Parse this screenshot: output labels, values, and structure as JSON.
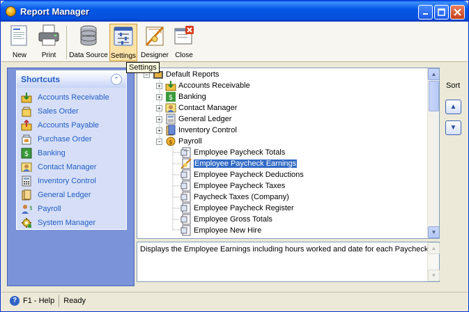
{
  "window": {
    "title": "Report Manager"
  },
  "toolbar": {
    "items": [
      {
        "label": "New",
        "icon": "new-document-icon"
      },
      {
        "label": "Print",
        "icon": "printer-icon"
      },
      {
        "label": "Data Source",
        "icon": "database-icon"
      },
      {
        "label": "Settings",
        "icon": "settings-icon",
        "active": true
      },
      {
        "label": "Designer",
        "icon": "designer-icon"
      },
      {
        "label": "Close",
        "icon": "close-document-icon"
      }
    ],
    "tooltip": "Settings"
  },
  "shortcuts": {
    "title": "Shortcuts",
    "items": [
      "Accounts Receivable",
      "Sales Order",
      "Accounts Payable",
      "Purchase Order",
      "Banking",
      "Contact Manager",
      "Inventory Control",
      "General Ledger",
      "Payroll",
      "System Manager"
    ]
  },
  "tree": {
    "root": "Default Reports",
    "categories": [
      "Accounts Receivable",
      "Banking",
      "Contact Manager",
      "General Ledger",
      "Inventory Control",
      "Payroll"
    ],
    "payroll_reports": [
      "Employee Paycheck Totals",
      "Employee Paycheck Earnings",
      "Employee Paycheck Deductions",
      "Employee Paycheck Taxes",
      "Paycheck Taxes (Company)",
      "Employee Paycheck Register",
      "Employee Gross Totals",
      "Employee New Hire"
    ],
    "selected": "Employee Paycheck Earnings"
  },
  "description": "Displays the Employee Earnings including hours worked and date for each Paycheck.",
  "sort": {
    "label": "Sort"
  },
  "status": {
    "help": "F1 - Help",
    "state": "Ready"
  },
  "colors": {
    "title_bar": "#0557e6",
    "selection": "#316ac5",
    "link": "#215dc6",
    "left_pane": "#7b93d8"
  }
}
